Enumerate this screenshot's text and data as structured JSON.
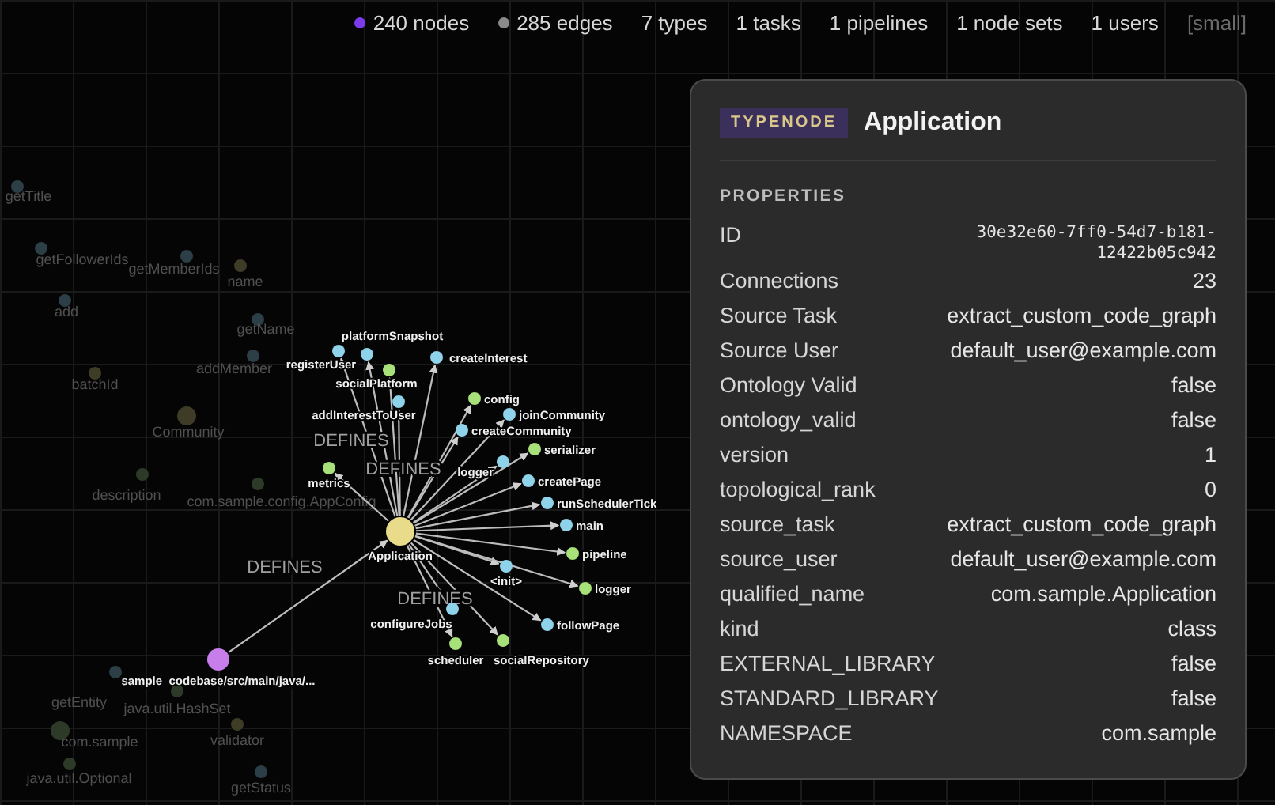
{
  "stats": [
    {
      "text": "240 nodes",
      "kind": "dot",
      "color": "#7c3aed"
    },
    {
      "text": "285 edges",
      "kind": "dot",
      "color": "#8a8a8a"
    },
    {
      "text": "7 types",
      "kind": "plain"
    },
    {
      "text": "1 tasks",
      "kind": "plain"
    },
    {
      "text": "1 pipelines",
      "kind": "plain"
    },
    {
      "text": "1 node sets",
      "kind": "plain"
    },
    {
      "text": "1 users",
      "kind": "plain"
    },
    {
      "text": "[small]",
      "kind": "muted"
    }
  ],
  "graph": {
    "background_nodes": [
      {
        "label": "getTitle",
        "color": "#2c3e46"
      },
      {
        "label": "getFollowerIds",
        "color": "#2c3e46"
      },
      {
        "label": "getMemberIds",
        "color": "#2c3e46"
      },
      {
        "label": "name",
        "color": "#3e3c26"
      },
      {
        "label": "add",
        "color": "#2c3e46"
      },
      {
        "label": "getName",
        "color": "#2c3e46"
      },
      {
        "label": "addMember",
        "color": "#2c3e46"
      },
      {
        "label": "batchId",
        "color": "#3e3c26"
      },
      {
        "label": "Community",
        "color": "#3e3c26"
      },
      {
        "label": "description",
        "color": "#2e3a28"
      },
      {
        "label": "com.sample.config.AppConfig",
        "color": "#2e3a28"
      },
      {
        "label": "getEntity",
        "color": "#2c3e46"
      },
      {
        "label": "java.util.HashSet",
        "color": "#2e3a28"
      },
      {
        "label": "com.sample",
        "color": "#2e3a28"
      },
      {
        "label": "validator",
        "color": "#3e3c26"
      },
      {
        "label": "java.util.Optional",
        "color": "#2e3a28"
      },
      {
        "label": "getStatus",
        "color": "#2c3e46"
      }
    ],
    "hub": {
      "label": "Application",
      "color": "#e8dc8a"
    },
    "nodes": [
      {
        "label": "registerUser",
        "color": "#8fd3ea"
      },
      {
        "label": "platformSnapshot",
        "color": "#8fd3ea"
      },
      {
        "label": "createInterest",
        "color": "#8fd3ea"
      },
      {
        "label": "socialPlatform",
        "color": "#a8e07a"
      },
      {
        "label": "config",
        "color": "#a8e07a"
      },
      {
        "label": "addInterestToUser",
        "color": "#8fd3ea"
      },
      {
        "label": "joinCommunity",
        "color": "#8fd3ea"
      },
      {
        "label": "createCommunity",
        "color": "#8fd3ea"
      },
      {
        "label": "serializer",
        "color": "#a8e07a"
      },
      {
        "label": "logger",
        "color": "#8fd3ea"
      },
      {
        "label": "metrics",
        "color": "#a8e07a"
      },
      {
        "label": "createPage",
        "color": "#8fd3ea"
      },
      {
        "label": "runSchedulerTick",
        "color": "#8fd3ea"
      },
      {
        "label": "main",
        "color": "#8fd3ea"
      },
      {
        "label": "pipeline",
        "color": "#a8e07a"
      },
      {
        "label": "<init>",
        "color": "#8fd3ea"
      },
      {
        "label": "logger",
        "color": "#a8e07a"
      },
      {
        "label": "configureJobs",
        "color": "#8fd3ea"
      },
      {
        "label": "followPage",
        "color": "#8fd3ea"
      },
      {
        "label": "scheduler",
        "color": "#a8e07a"
      },
      {
        "label": "socialRepository",
        "color": "#a8e07a"
      },
      {
        "label": "sample_codebase/src/main/java/...",
        "color": "#c77dea"
      }
    ],
    "edge_labels": [
      "DEFINES",
      "DEFINES",
      "DEFINES",
      "DEFINES"
    ]
  },
  "panel": {
    "badge": "TYPENODE",
    "title": "Application",
    "section": "PROPERTIES",
    "rows": [
      {
        "key": "ID",
        "value": "30e32e60-7ff0-54d7-b181-12422b05c942",
        "kind": "mono"
      },
      {
        "key": "Connections",
        "value": "23",
        "kind": "text"
      },
      {
        "key": "Source Task",
        "value": "extract_custom_code_graph",
        "kind": "text"
      },
      {
        "key": "Source User",
        "value": "default_user@example.com",
        "kind": "text"
      },
      {
        "key": "Ontology Valid",
        "value": "false",
        "kind": "text"
      },
      {
        "key": "ontology_valid",
        "value": "false",
        "kind": "text"
      },
      {
        "key": "version",
        "value": "1",
        "kind": "text"
      },
      {
        "key": "topological_rank",
        "value": "0",
        "kind": "text"
      },
      {
        "key": "source_task",
        "value": "extract_custom_code_graph",
        "kind": "text"
      },
      {
        "key": "source_user",
        "value": "default_user@example.com",
        "kind": "text"
      },
      {
        "key": "qualified_name",
        "value": "com.sample.Application",
        "kind": "text"
      },
      {
        "key": "kind",
        "value": "class",
        "kind": "text"
      },
      {
        "key": "EXTERNAL_LIBRARY",
        "value": "false",
        "kind": "text"
      },
      {
        "key": "STANDARD_LIBRARY",
        "value": "false",
        "kind": "text"
      },
      {
        "key": "NAMESPACE",
        "value": "com.sample",
        "kind": "text"
      }
    ]
  }
}
